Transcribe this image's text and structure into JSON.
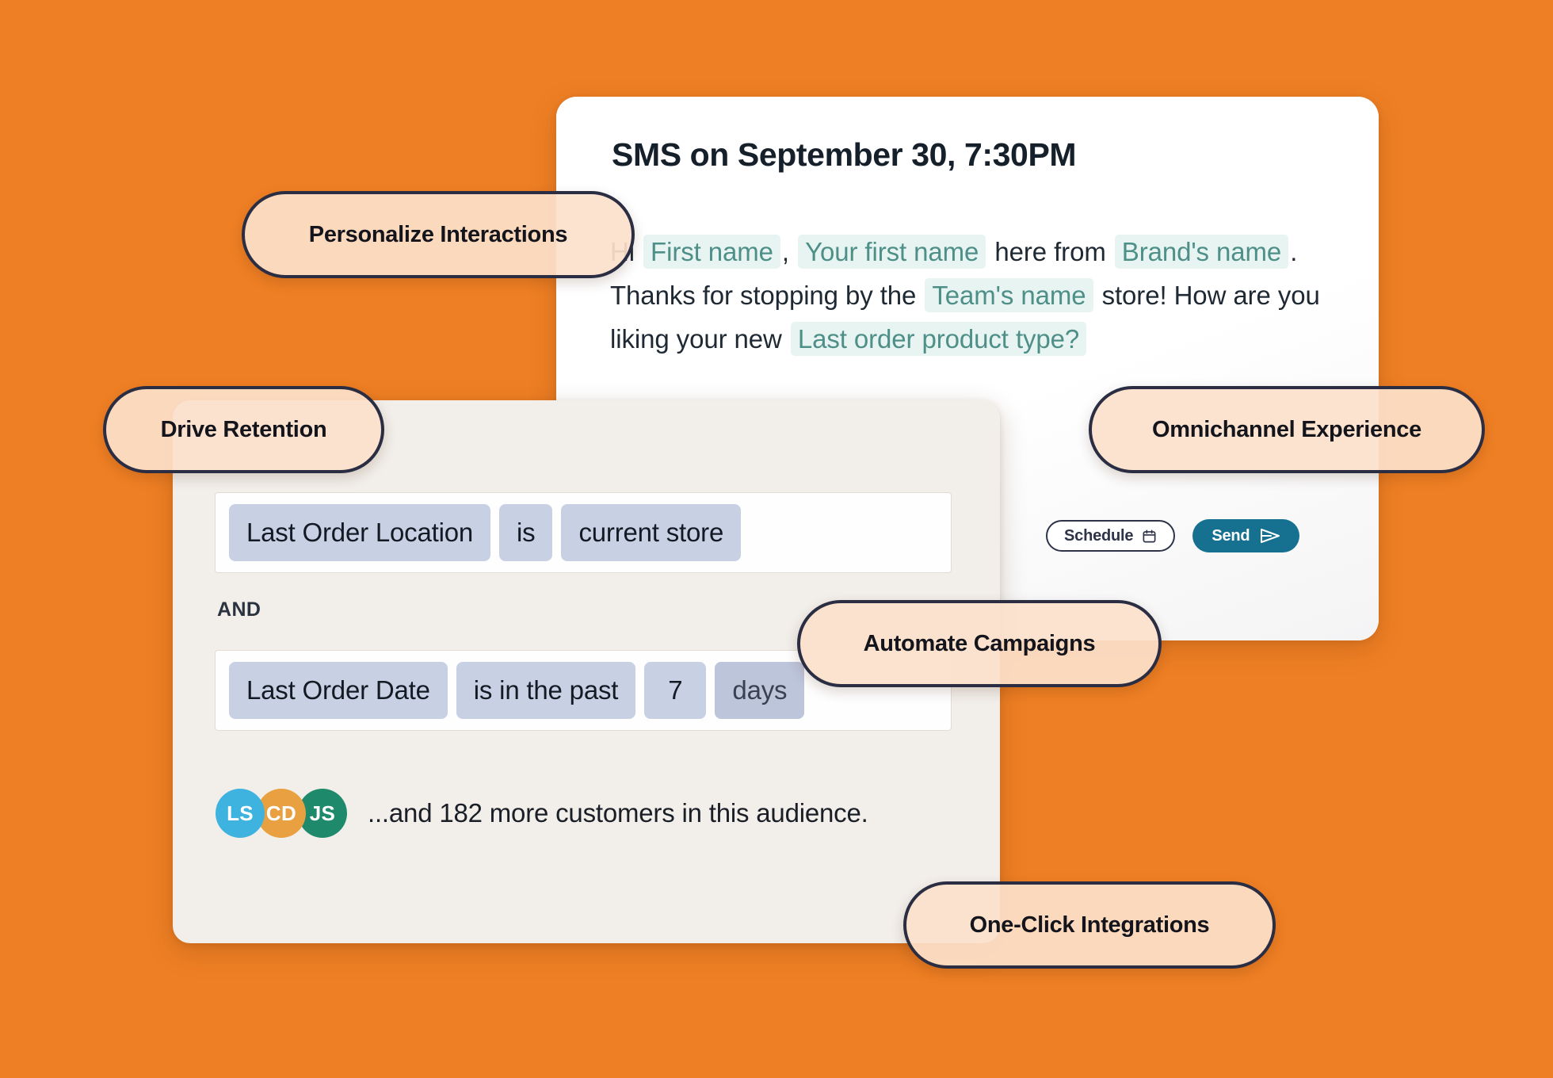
{
  "background_color": "#EF7F24",
  "sms_card": {
    "title": "SMS on September 30, 7:30PM",
    "message": {
      "segments": [
        {
          "type": "text",
          "value": "Hi"
        },
        {
          "type": "token",
          "value": "First name"
        },
        {
          "type": "text",
          "value": ","
        },
        {
          "type": "token",
          "value": "Your first name"
        },
        {
          "type": "text",
          "value": "here from"
        },
        {
          "type": "token",
          "value": "Brand's name"
        },
        {
          "type": "text",
          "value": ". Thanks for stopping by the"
        },
        {
          "type": "token",
          "value": "Team's name"
        },
        {
          "type": "text",
          "value": "store! How are you liking your new"
        },
        {
          "type": "token",
          "value": "Last order product type?"
        }
      ],
      "token_bg": "#E7F4F2",
      "token_color": "#4E8F88"
    },
    "actions": {
      "schedule_label": "Schedule",
      "schedule_icon": "calendar-icon",
      "send_label": "Send",
      "send_icon": "paper-plane-icon",
      "send_bg": "#15718F"
    }
  },
  "segment_card": {
    "conditions": [
      {
        "field": "Last Order Location",
        "operator": "is",
        "value": "current store"
      },
      {
        "field": "Last Order Date",
        "operator": "is in the past",
        "amount": "7",
        "unit": "days"
      }
    ],
    "join_operator": "AND",
    "chip_color": "#C8D0E4",
    "audience": {
      "avatars": [
        {
          "initials": "LS",
          "color": "#3FB3DF"
        },
        {
          "initials": "CD",
          "color": "#E9A040"
        },
        {
          "initials": "JS",
          "color": "#1F8A6B"
        }
      ],
      "summary": "...and 182 more customers in this audience.",
      "more_count": 182
    }
  },
  "feature_pills": [
    {
      "id": "personalize",
      "label": "Personalize Interactions"
    },
    {
      "id": "retention",
      "label": "Drive Retention"
    },
    {
      "id": "omnichannel",
      "label": "Omnichannel Experience"
    },
    {
      "id": "automate",
      "label": "Automate Campaigns"
    },
    {
      "id": "oneclick",
      "label": "One-Click Integrations"
    }
  ],
  "pill_style": {
    "fill": "#FCE1CB",
    "border": "#2B2D42"
  }
}
